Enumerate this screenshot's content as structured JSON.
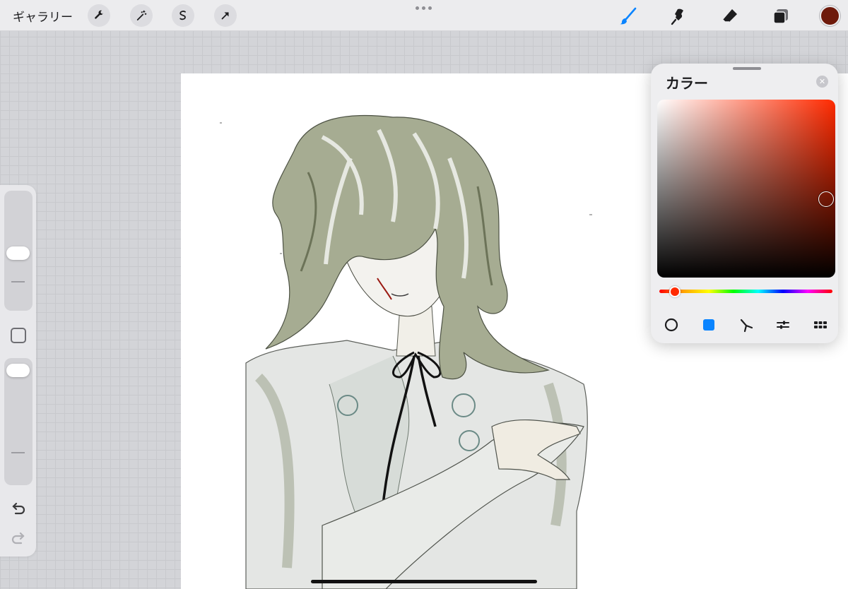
{
  "toolbar": {
    "gallery_label": "ギャラリー",
    "left_tools": [
      {
        "icon": "wrench-icon"
      },
      {
        "icon": "magic-wand-icon"
      },
      {
        "icon": "selection-icon"
      },
      {
        "icon": "transform-arrow-icon"
      }
    ],
    "right_tools": [
      {
        "icon": "brush-icon",
        "active": true
      },
      {
        "icon": "smudge-icon",
        "active": false
      },
      {
        "icon": "eraser-icon",
        "active": false
      },
      {
        "icon": "layers-icon",
        "active": false
      }
    ],
    "current_color": "#6e1a0b",
    "accent_color": "#0a84ff"
  },
  "sidebar": {
    "size_level": 0.48,
    "opacity_level": 0.95,
    "undo_icon": "undo-icon",
    "redo_icon": "redo-icon"
  },
  "color_panel": {
    "title": "カラー",
    "close_icon": "close-icon",
    "hue_level": 0.09,
    "saturation": 0.95,
    "brightness": 0.44,
    "modes": [
      {
        "icon": "disc-mode-icon",
        "active": false
      },
      {
        "icon": "classic-mode-icon",
        "active": true
      },
      {
        "icon": "harmony-mode-icon",
        "active": false
      },
      {
        "icon": "value-mode-icon",
        "active": false
      },
      {
        "icon": "palette-mode-icon",
        "active": false
      }
    ]
  }
}
